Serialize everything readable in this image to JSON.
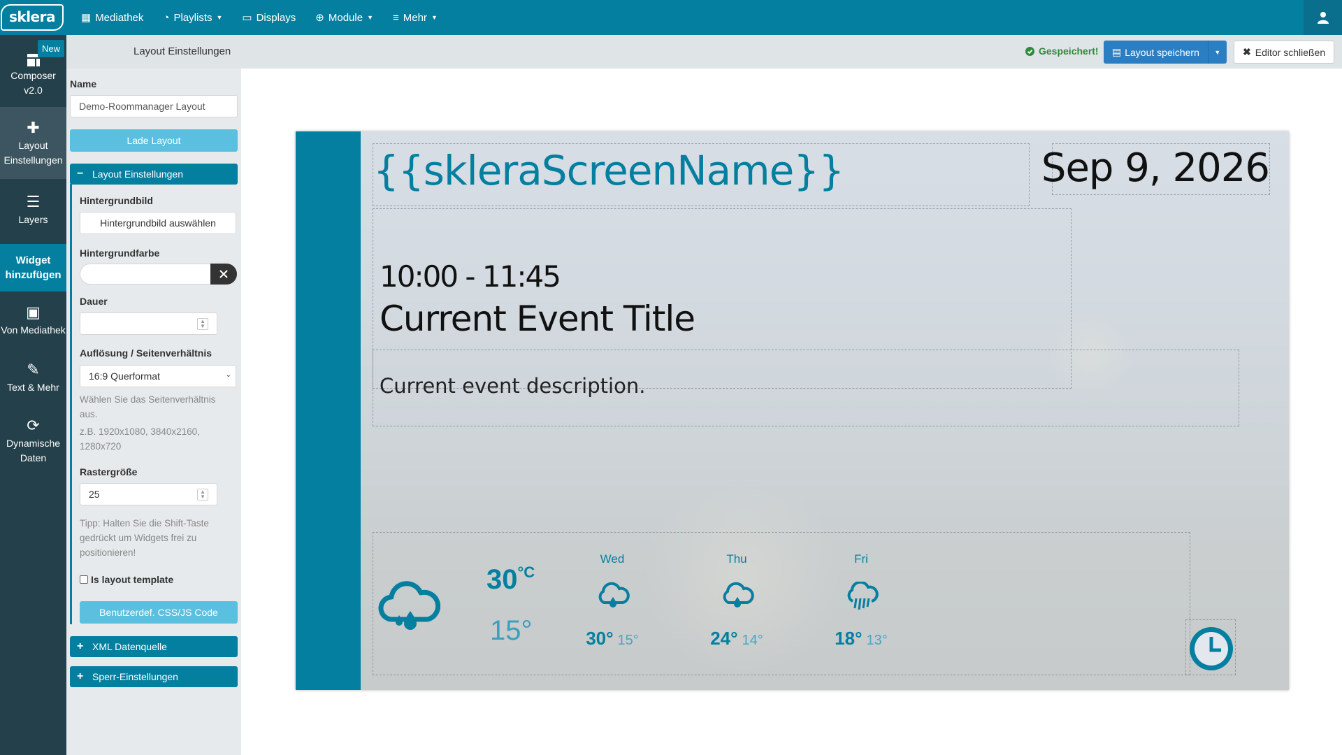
{
  "nav": {
    "logo": "sklera",
    "items": [
      "Mediathek",
      "Playlists",
      "Displays",
      "Module",
      "Mehr"
    ]
  },
  "sidebar": {
    "composer_line1": "Composer",
    "composer_line2": "v2.0",
    "new_badge": "New",
    "layout_line1": "Layout",
    "layout_line2": "Einstellungen",
    "layers": "Layers",
    "widget_line1": "Widget",
    "widget_line2": "hinzufügen",
    "mediathek": "Von Mediathek",
    "text": "Text & Mehr",
    "dyn_line1": "Dynamische",
    "dyn_line2": "Daten"
  },
  "header": {
    "title": "Layout Einstellungen",
    "saved": "Gespeichert!",
    "save_button": "Layout speichern",
    "close_button": "Editor schließen"
  },
  "panel": {
    "name_label": "Name",
    "name_value": "Demo-Roommanager Layout",
    "load_button": "Lade Layout",
    "section_layout": "Layout Einstellungen",
    "bg_image_label": "Hintergrundbild",
    "bg_image_button": "Hintergrundbild auswählen",
    "bg_color_label": "Hintergrundfarbe",
    "duration_label": "Dauer",
    "duration_value": "",
    "resolution_label": "Auflösung / Seitenverhältnis",
    "resolution_value": "16:9 Querformat",
    "resolution_help1": "Wählen Sie das Seitenverhältnis aus.",
    "resolution_help2": "z.B. 1920x1080, 3840x2160, 1280x720",
    "grid_label": "Rastergröße",
    "grid_value": "25",
    "grid_help": "Tipp: Halten Sie die Shift-Taste gedrückt um Widgets frei zu positionieren!",
    "template_label": "Is layout template",
    "css_button": "Benutzerdef. CSS/JS Code",
    "section_xml": "XML Datenquelle",
    "section_lock": "Sperr-Einstellungen"
  },
  "stage": {
    "screen_name": "{{skleraScreenName}}",
    "date": "Sep 9, 2026",
    "event_time": "10:00 - 11:45",
    "event_title": "Current Event Title",
    "event_description": "Current event description.",
    "accent": "#057fa0",
    "weather": {
      "current_high": "30",
      "current_unit": "°C",
      "current_low": "15°",
      "days": [
        {
          "name": "Wed",
          "high": "30°",
          "low": "15°",
          "icon": "rain-cloud-icon"
        },
        {
          "name": "Thu",
          "high": "24°",
          "low": "14°",
          "icon": "rain-cloud-icon"
        },
        {
          "name": "Fri",
          "high": "18°",
          "low": "13°",
          "icon": "shower-cloud-icon"
        }
      ]
    }
  }
}
